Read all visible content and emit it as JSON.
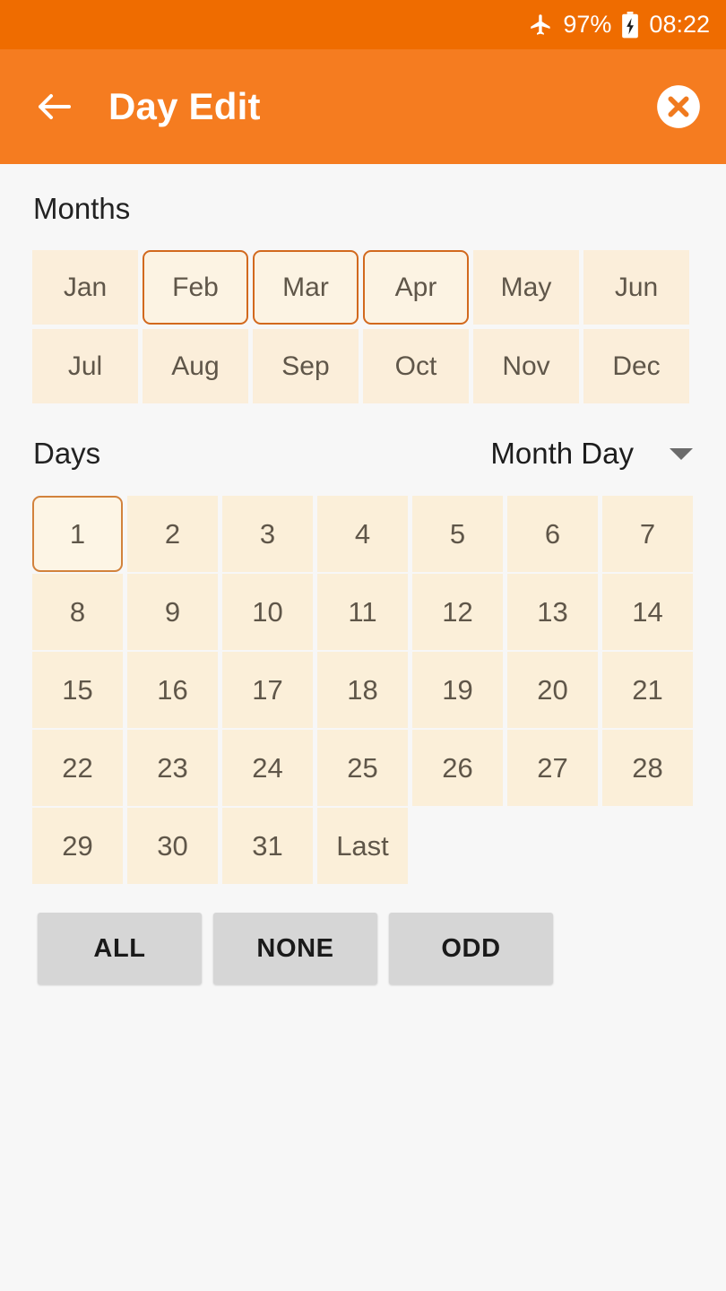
{
  "status_bar": {
    "airplane_icon": "airplane-mode-icon",
    "battery_percent": "97%",
    "battery_icon": "battery-charging-icon",
    "time": "08:22",
    "background_color": "#ef6c00"
  },
  "app_bar": {
    "back_icon": "arrow-left-icon",
    "title": "Day Edit",
    "close_icon": "close-circle-icon",
    "background_color": "#f57c20"
  },
  "months_section": {
    "label": "Months",
    "cells": [
      {
        "label": "Jan",
        "selected": false
      },
      {
        "label": "Feb",
        "selected": true
      },
      {
        "label": "Mar",
        "selected": true
      },
      {
        "label": "Apr",
        "selected": true
      },
      {
        "label": "May",
        "selected": false
      },
      {
        "label": "Jun",
        "selected": false
      },
      {
        "label": "Jul",
        "selected": false
      },
      {
        "label": "Aug",
        "selected": false
      },
      {
        "label": "Sep",
        "selected": false
      },
      {
        "label": "Oct",
        "selected": false
      },
      {
        "label": "Nov",
        "selected": false
      },
      {
        "label": "Dec",
        "selected": false
      }
    ],
    "cell_color": "#fbeeda",
    "selected_border_color": "#d2691e"
  },
  "days_section": {
    "label": "Days",
    "mode_selected": "Month Day",
    "mode_caret_icon": "chevron-down-icon",
    "cells": [
      {
        "label": "1",
        "selected": true
      },
      {
        "label": "2",
        "selected": false
      },
      {
        "label": "3",
        "selected": false
      },
      {
        "label": "4",
        "selected": false
      },
      {
        "label": "5",
        "selected": false
      },
      {
        "label": "6",
        "selected": false
      },
      {
        "label": "7",
        "selected": false
      },
      {
        "label": "8",
        "selected": false
      },
      {
        "label": "9",
        "selected": false
      },
      {
        "label": "10",
        "selected": false
      },
      {
        "label": "11",
        "selected": false
      },
      {
        "label": "12",
        "selected": false
      },
      {
        "label": "13",
        "selected": false
      },
      {
        "label": "14",
        "selected": false
      },
      {
        "label": "15",
        "selected": false
      },
      {
        "label": "16",
        "selected": false
      },
      {
        "label": "17",
        "selected": false
      },
      {
        "label": "18",
        "selected": false
      },
      {
        "label": "19",
        "selected": false
      },
      {
        "label": "20",
        "selected": false
      },
      {
        "label": "21",
        "selected": false
      },
      {
        "label": "22",
        "selected": false
      },
      {
        "label": "23",
        "selected": false
      },
      {
        "label": "24",
        "selected": false
      },
      {
        "label": "25",
        "selected": false
      },
      {
        "label": "26",
        "selected": false
      },
      {
        "label": "27",
        "selected": false
      },
      {
        "label": "28",
        "selected": false
      },
      {
        "label": "29",
        "selected": false
      },
      {
        "label": "30",
        "selected": false
      },
      {
        "label": "31",
        "selected": false
      },
      {
        "label": "Last",
        "selected": false
      }
    ],
    "cell_color": "#fbefd9",
    "selected_border_color": "#d2823c"
  },
  "actions": {
    "buttons": [
      {
        "label": "ALL"
      },
      {
        "label": "NONE"
      },
      {
        "label": "ODD"
      }
    ],
    "button_color": "#d6d6d6"
  }
}
